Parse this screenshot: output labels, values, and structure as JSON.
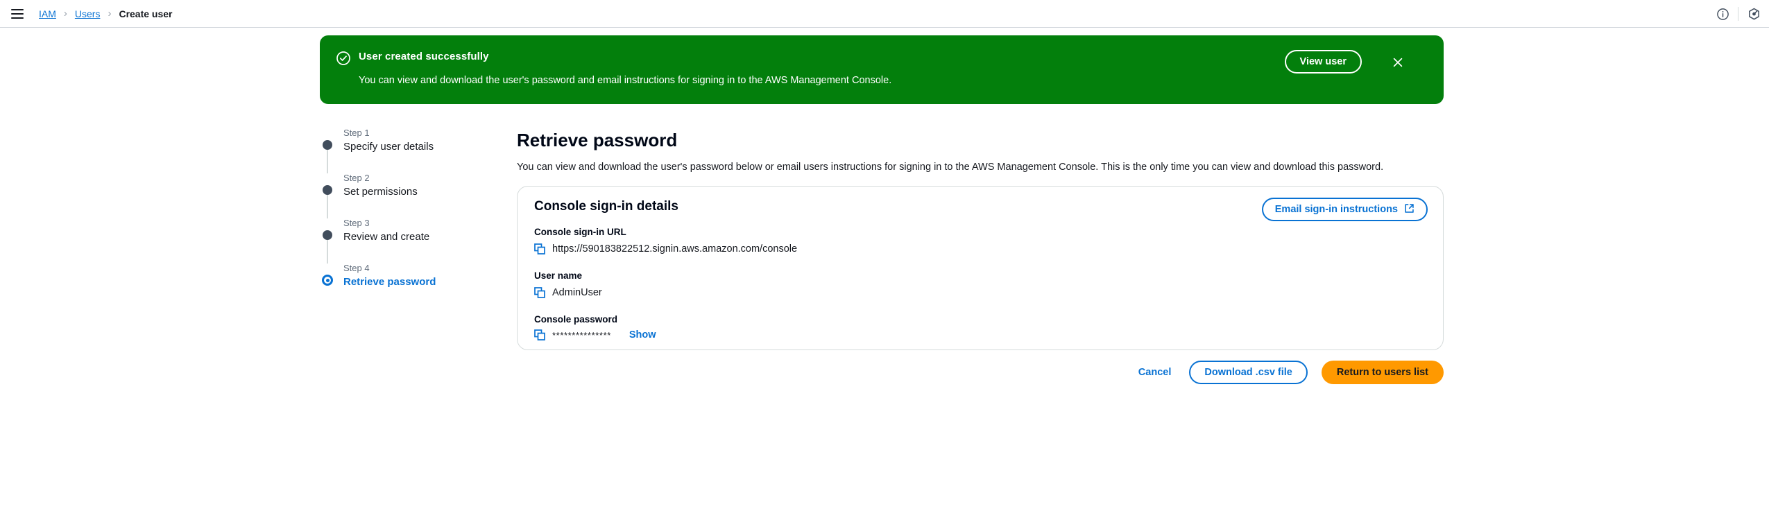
{
  "topbar": {
    "menu_icon": "hamburger-menu-icon",
    "breadcrumb": {
      "items": [
        {
          "label": "IAM",
          "type": "link"
        },
        {
          "label": "Users",
          "type": "link"
        },
        {
          "label": "Create user",
          "type": "current"
        }
      ],
      "separator": "›"
    },
    "right_icons": [
      {
        "name": "info-icon",
        "glyph": "i"
      },
      {
        "name": "settings-icon",
        "glyph": "settings"
      }
    ]
  },
  "flash": {
    "status_icon": "success-check-circle-icon",
    "title": "User created successfully",
    "body": "You can view and download the user's password and email instructions for signing in to the AWS Management Console.",
    "action_label": "View user",
    "close_icon": "close-icon",
    "background_color": "#037f0c"
  },
  "wizard": {
    "steps": [
      {
        "number": "Step 1",
        "title": "Specify user details",
        "active": false
      },
      {
        "number": "Step 2",
        "title": "Set permissions",
        "active": false
      },
      {
        "number": "Step 3",
        "title": "Review and create",
        "active": false
      },
      {
        "number": "Step 4",
        "title": "Retrieve password",
        "active": true
      }
    ],
    "active_color": "#0972d3",
    "inactive_dot_color": "#414d5c"
  },
  "main": {
    "title": "Retrieve password",
    "description": "You can view and download the user's password below or email users instructions for signing in to the AWS Management Console. This is the only time you can view and download this password."
  },
  "card": {
    "title": "Console sign-in details",
    "email_button": {
      "label": "Email sign-in instructions",
      "icon": "external-link-icon"
    },
    "fields": [
      {
        "label": "Console sign-in URL",
        "value": "https://590183822512.signin.aws.amazon.com/console",
        "copy_icon": "copy-icon",
        "masked": false
      },
      {
        "label": "User name",
        "value": "AdminUser",
        "copy_icon": "copy-icon",
        "masked": false
      },
      {
        "label": "Console password",
        "value": "***************",
        "copy_icon": "copy-icon",
        "masked": true,
        "toggle_label": "Show"
      }
    ]
  },
  "footer": {
    "cancel_label": "Cancel",
    "download_label": "Download .csv file",
    "primary_label": "Return to users list",
    "primary_color": "#ff9900"
  }
}
